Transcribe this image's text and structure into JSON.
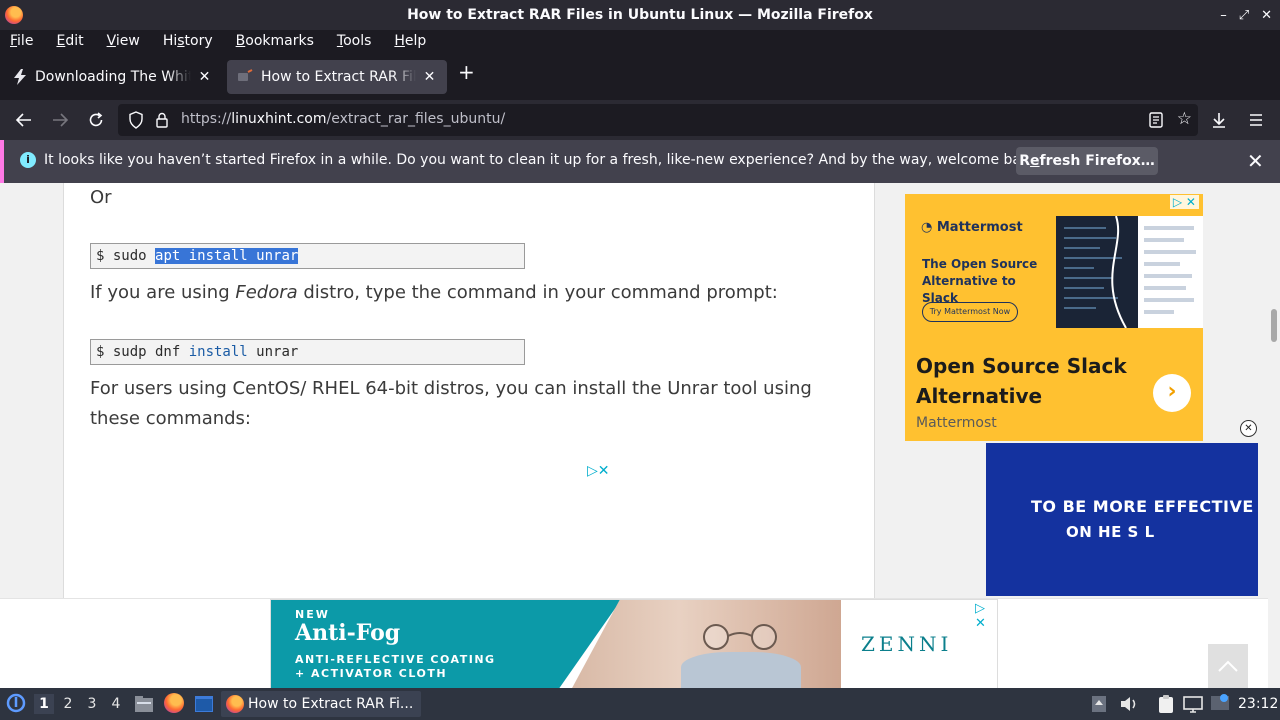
{
  "window": {
    "title": "How to Extract RAR Files in Ubuntu Linux — Mozilla Firefox",
    "controls": [
      "–",
      "⤢",
      "✕"
    ]
  },
  "menu": [
    {
      "label": "File",
      "accel": "F",
      "rest": "ile"
    },
    {
      "label": "Edit",
      "accel": "E",
      "rest": "dit"
    },
    {
      "label": "View",
      "accel": "V",
      "rest": "iew"
    },
    {
      "label": "History",
      "pre": "Hi",
      "accel": "s",
      "rest": "tory"
    },
    {
      "label": "Bookmarks",
      "accel": "B",
      "rest": "ookmarks"
    },
    {
      "label": "Tools",
      "accel": "T",
      "rest": "ools"
    },
    {
      "label": "Help",
      "accel": "H",
      "rest": "elp"
    }
  ],
  "tabs": [
    {
      "title": "Downloading The White House",
      "icon": "bolt-icon",
      "active": false
    },
    {
      "title": "How to Extract RAR Files in Ubuntu Linux",
      "icon": "site-favicon",
      "active": true
    }
  ],
  "newtab": "+",
  "nav": {
    "url_prefix": "https://",
    "url_domain": "linuxhint.com",
    "url_path": "/extract_rar_files_ubuntu/"
  },
  "notification": {
    "message": "It looks like you haven’t started Firefox in a while. Do you want to clean it up for a fresh, like-new experience? And by the way, welcome back!",
    "button_pre": "R",
    "button_accel": "e",
    "button_rest": "fresh Firefox…"
  },
  "article": {
    "or_text": "Or",
    "code1_prompt": "$ sudo ",
    "code1_selected": "apt install unrar",
    "fedora_pre": "If you are using ",
    "fedora_em": "Fedora",
    "fedora_post": " distro, type the command in your command prompt:",
    "code2_prompt": "$ sudp dnf ",
    "code2_kw": "install",
    "code2_rest": " unrar",
    "centos_text": "For users using CentOS/ RHEL 64-bit distros, you can install the Unrar tool using these commands:"
  },
  "ads": {
    "right": {
      "brand": "Mattermost",
      "headline": "The Open Source Alternative to Slack",
      "cta": "Try Mattermost Now",
      "big": "Open Source Slack Alternative",
      "advertiser": "Mattermost"
    },
    "blue": {
      "line1": "TO BE MORE EFFECTIVE",
      "line2": "ON  HE S     L"
    },
    "bottom": {
      "new": "NEW",
      "title": "Anti-Fog",
      "sub1": "ANTI-REFLECTIVE COATING",
      "sub2": "+ ACTIVATOR CLOTH",
      "brand": "ZENNI"
    }
  },
  "taskbar": {
    "workspaces": [
      "1",
      "2",
      "3",
      "4"
    ],
    "active_workspace": "1",
    "task_label": "How to Extract RAR Fi...",
    "clock": "23:12"
  }
}
